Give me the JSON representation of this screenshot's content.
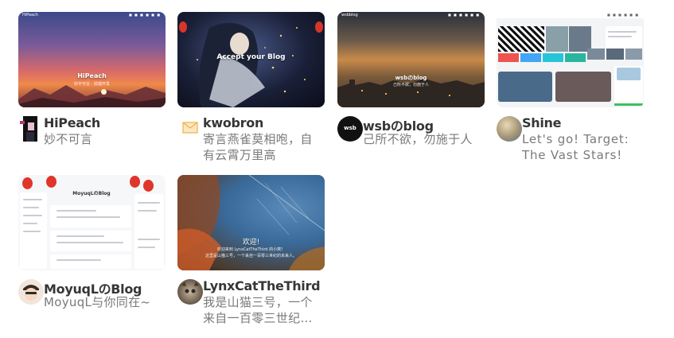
{
  "sites": [
    {
      "name": "HiPeach",
      "description": "妙不可言",
      "preview_title": "HiPeach",
      "preview_subtitle": "妙不可言 · 前端开发",
      "preview_logo": "HiPeach",
      "preview_menu": "■ ■ ■ ■ ■ ■"
    },
    {
      "name": "kwobron",
      "description": "寄言燕雀莫相咆，自有云霄万里高",
      "preview_title": "Accept your Blog",
      "preview_logo": "",
      "preview_menu": "■ ■ ■ ■"
    },
    {
      "name": "wsbのblog",
      "description": "己所不欲，勿施于人",
      "preview_title": "wsbのblog",
      "preview_subtitle": "己所不欲，勿施于人",
      "preview_logo": "wsbblog",
      "preview_menu": "■ ■ ■ ■ ■ ■"
    },
    {
      "name": "Shine",
      "description": "Let's go! Target: The Vast Stars!",
      "preview_logo": "",
      "preview_menu": "■ ■ ■ ■ ■ ■"
    },
    {
      "name": "MoyuqLのBlog",
      "description": "MoyuqL与你同在~",
      "preview_title": "MoyuqLのBlog"
    },
    {
      "name": "LynxCatTheThird",
      "description": "我是山猫三号，一个来自一百零三世纪…",
      "preview_title": "欢迎!",
      "preview_subtitle": "欢迎来到 LynxCatTheThird 的小窝！",
      "preview_subtitle2": "这里是山猫三号，一个来自一百零三世纪的未来人。"
    }
  ],
  "colors": {
    "name_text": "#363636",
    "desc_text": "#7a7a7a",
    "background": "#ffffff"
  }
}
